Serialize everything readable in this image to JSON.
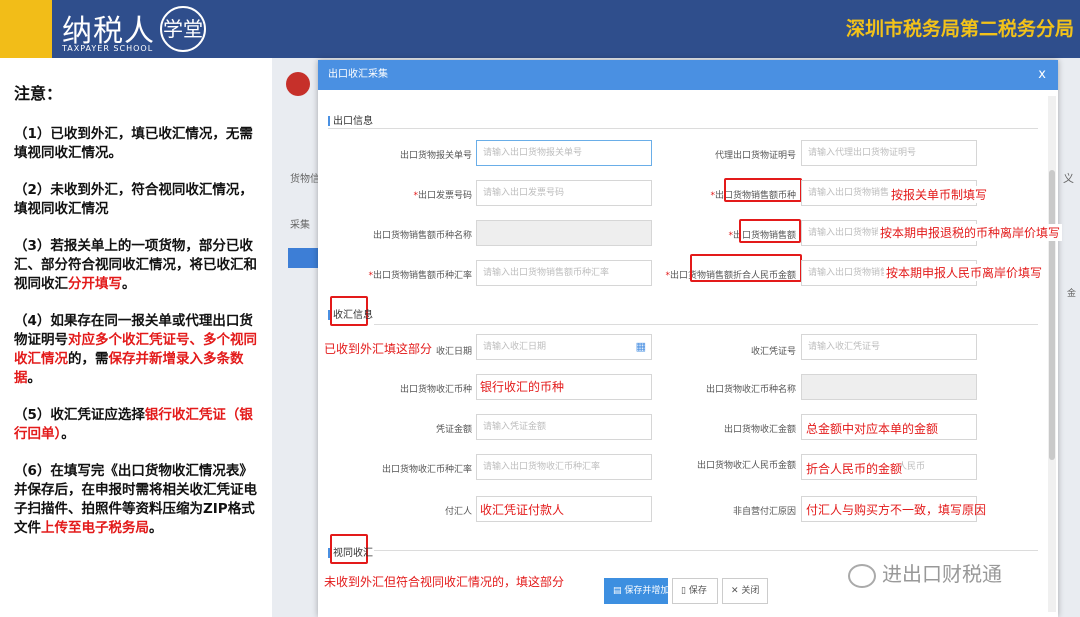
{
  "banner": {
    "logo_text": "纳税人",
    "logo_sub": "TAXPAYER SCHOOL",
    "logo_seal": "学堂",
    "bureau": "深圳市税务局第二税务分局"
  },
  "notes": {
    "title": "注意：",
    "n1": "（1）已收到外汇，填已收汇情况，无需填视同收汇情况。",
    "n2": "（2）未收到外汇，符合视同收汇情况，填视同收汇情况",
    "n3a": "（3）若报关单上的一项货物，部分已收汇、部分符合视同收汇情况，将已收汇和视同收汇",
    "n3b": "分开填写",
    "n3c": "。",
    "n4a": "（4）如果存在同一报关单或代理出口货物证明号",
    "n4b": "对应多个收汇凭证号、多个视同收汇情况",
    "n4c": "的，需",
    "n4d": "保存并新增录入多条数据",
    "n4e": "。",
    "n5a": "（5）收汇凭证应选择",
    "n5b": "银行收汇凭证（银行回单）",
    "n5c": "。",
    "n6a": "（6）在填写完《出口货物收汇情况表》并保存后，在申报时需将相关收汇凭证电子扫描件、拍照件等资料压缩为ZIP格式文件",
    "n6b": "上传至电子税务局",
    "n6c": "。"
  },
  "app_bg": {
    "side_tab": "货物信",
    "side_tab2": "采集",
    "right_text": "义",
    "right_text2": "金"
  },
  "modal": {
    "title": "出口收汇采集",
    "close": "x",
    "section1": "出口信息",
    "section2": "收汇信息",
    "section3": "视同收汇",
    "fields": {
      "decl_no": {
        "label": "出口货物报关单号",
        "placeholder": "请输入出口货物报关单号"
      },
      "agent_no": {
        "label": "代理出口货物证明号",
        "placeholder": "请输入代理出口货物证明号"
      },
      "invoice_no": {
        "label": "出口发票号码",
        "placeholder": "请输入出口发票号码"
      },
      "currency": {
        "label": "出口货物销售额币种",
        "placeholder": "请输入出口货物销售额币种"
      },
      "currency_name": {
        "label": "出口货物销售额币种名称",
        "placeholder": ""
      },
      "amount": {
        "label": "出口货物销售额",
        "placeholder": "请输入出口货物销售额"
      },
      "rate": {
        "label": "出口货物销售额币种汇率",
        "placeholder": "请输入出口货物销售额币种汇率"
      },
      "rmb_amount": {
        "label": "出口货物销售额折合人民币金额",
        "placeholder": "请输入出口货物销售额折合人民币金额"
      },
      "recv_date": {
        "label": "收汇日期",
        "placeholder": "请输入收汇日期"
      },
      "voucher_no": {
        "label": "收汇凭证号",
        "placeholder": "请输入收汇凭证号"
      },
      "recv_currency": {
        "label": "出口货物收汇币种",
        "placeholder": ""
      },
      "recv_currency_name": {
        "label": "出口货物收汇币种名称",
        "placeholder": ""
      },
      "voucher_amount": {
        "label": "凭证金额",
        "placeholder": "请输入凭证金额"
      },
      "recv_amount": {
        "label": "出口货物收汇金额",
        "placeholder": ""
      },
      "recv_rate": {
        "label": "出口货物收汇币种汇率",
        "placeholder": "请输入出口货物收汇币种汇率"
      },
      "recv_rmb": {
        "label": "出口货物收汇人民币金额",
        "placeholder": "",
        "suffix": "人民币"
      },
      "payer": {
        "label": "付汇人",
        "placeholder": ""
      },
      "reason": {
        "label": "非自营付汇原因",
        "placeholder": ""
      }
    },
    "annotations": {
      "a_currency": "按报关单币制填写",
      "a_amount": "按本期申报退税的币种离岸价填写",
      "a_rmb": "按本期申报人民币离岸价填写",
      "a_received": "已收到外汇填这部分",
      "a_recv_currency": "银行收汇的币种",
      "a_recv_amount": "总金额中对应本单的金额",
      "a_recv_rmb": "折合人民币的金额",
      "a_payer": "收汇凭证付款人",
      "a_reason": "付汇人与购买方不一致，填写原因",
      "a_deemed": "未收到外汇但符合视同收汇情况的，填这部分"
    },
    "buttons": {
      "save_new": "保存并增加",
      "save": "保存",
      "close": "关闭"
    }
  },
  "watermark": "进出口财税通",
  "colors": {
    "banner_blue": "#2f4e8c",
    "banner_yellow": "#f2bd18",
    "modal_blue": "#4a90e2",
    "annotation_red": "#e31a1a"
  }
}
